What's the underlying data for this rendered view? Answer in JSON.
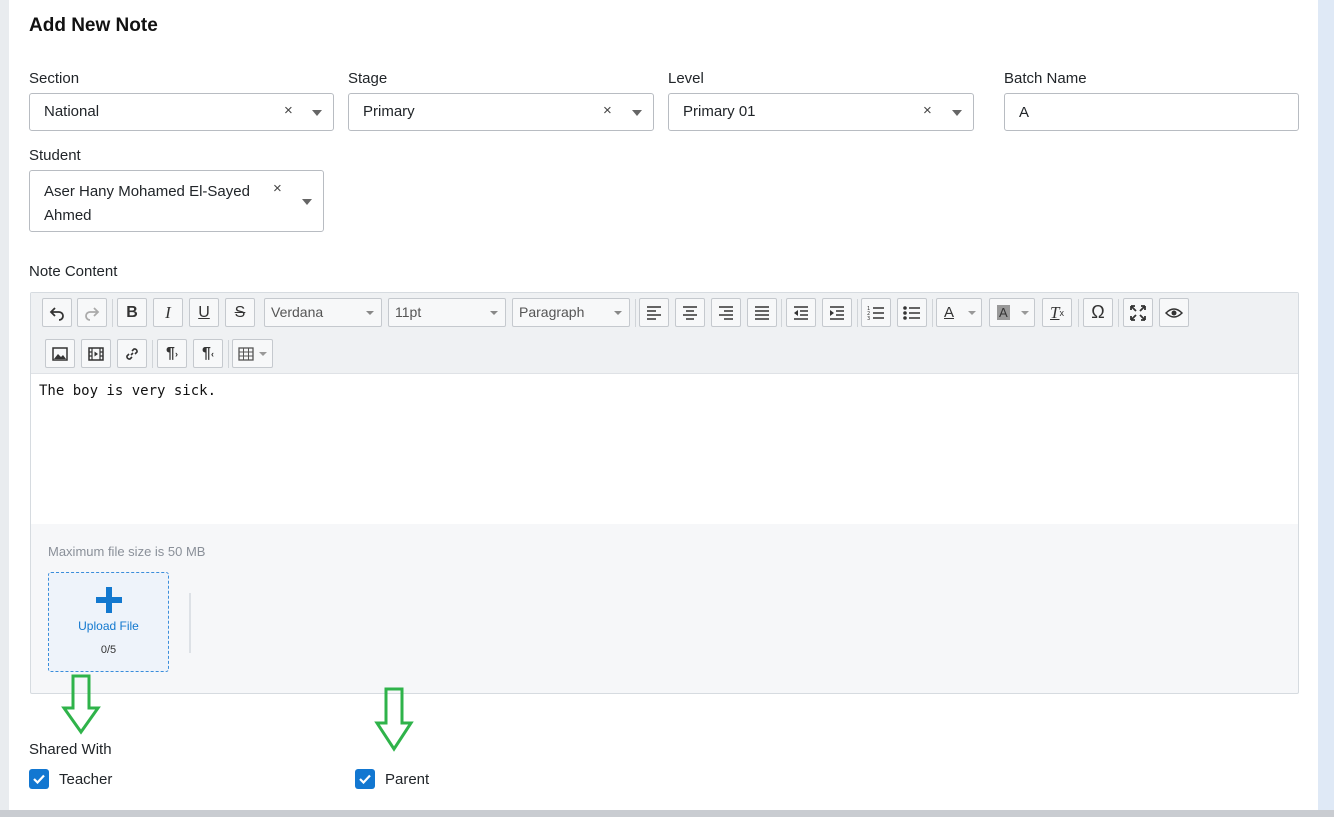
{
  "form": {
    "title": "Add New Note",
    "section": {
      "label": "Section",
      "value": "National"
    },
    "stage": {
      "label": "Stage",
      "value": "Primary"
    },
    "level": {
      "label": "Level",
      "value": "Primary 01"
    },
    "batch": {
      "label": "Batch Name",
      "value": "A"
    },
    "student": {
      "label": "Student",
      "value": "Aser Hany Mohamed El-Sayed Ahmed"
    },
    "clear_symbol": "×"
  },
  "editor": {
    "label": "Note Content",
    "font_family": "Verdana",
    "font_size": "11pt",
    "block_format": "Paragraph",
    "content": "The boy is very sick."
  },
  "upload": {
    "hint": "Maximum file size is 50 MB",
    "button_label": "Upload File",
    "count": "0/5"
  },
  "shared": {
    "label": "Shared With",
    "teacher": {
      "label": "Teacher",
      "checked": true
    },
    "parent": {
      "label": "Parent",
      "checked": true
    }
  },
  "colors": {
    "accent": "#1277d1",
    "annotation_arrow": "#2fb34a"
  }
}
